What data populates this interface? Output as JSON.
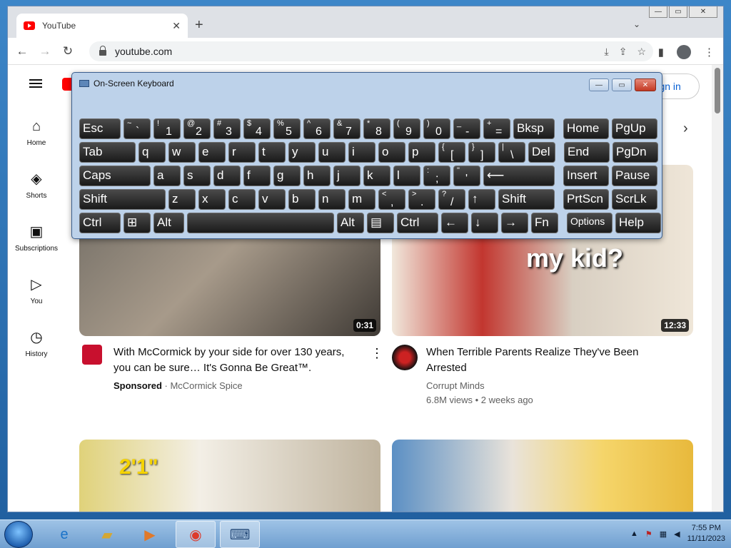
{
  "browser": {
    "tab_title": "YouTube",
    "url": "youtube.com"
  },
  "youtube": {
    "sign_in": "Sign in",
    "sidebar": [
      {
        "label": "Home",
        "icon": "home-icon"
      },
      {
        "label": "Shorts",
        "icon": "shorts-icon"
      },
      {
        "label": "Subscriptions",
        "icon": "subscriptions-icon"
      },
      {
        "label": "You",
        "icon": "you-icon"
      },
      {
        "label": "History",
        "icon": "history-icon"
      }
    ],
    "videos": [
      {
        "duration": "0:31",
        "title_line1": "With McCormick by your side for over 130 years,",
        "title_line2": "you can be sure… It's Gonna Be Great™.",
        "sponsored": "Sponsored",
        "channel": "McCormick Spice"
      },
      {
        "duration": "12:33",
        "overlay_text": "my kid?",
        "title_line1": "When Terrible Parents Realize They've Been",
        "title_line2": "Arrested",
        "channel": "Corrupt Minds",
        "stats": "6.8M views • 2 weeks ago"
      },
      {
        "overlay_text": "2'1\""
      },
      {}
    ]
  },
  "osk": {
    "title": "On-Screen Keyboard",
    "rows": [
      [
        "Esc",
        "~ `",
        "! 1",
        "@ 2",
        "# 3",
        "$ 4",
        "% 5",
        "^ 6",
        "& 7",
        "* 8",
        "( 9",
        ") 0",
        "_ -",
        "+ =",
        "Bksp",
        "Home",
        "PgUp"
      ],
      [
        "Tab",
        "q",
        "w",
        "e",
        "r",
        "t",
        "y",
        "u",
        "i",
        "o",
        "p",
        "{ [",
        "} ]",
        "| \\",
        "Del",
        "End",
        "PgDn"
      ],
      [
        "Caps",
        "a",
        "s",
        "d",
        "f",
        "g",
        "h",
        "j",
        "k",
        "l",
        ": ;",
        "\" '",
        "⟵",
        "Insert",
        "Pause"
      ],
      [
        "Shift",
        "z",
        "x",
        "c",
        "v",
        "b",
        "n",
        "m",
        "< ,",
        "> .",
        "? /",
        "↑",
        "Shift",
        "PrtScn",
        "ScrLk"
      ],
      [
        "Ctrl",
        "⊞",
        "Alt",
        "",
        "Alt",
        "▤",
        "Ctrl",
        "←",
        "↓",
        "→",
        "Fn",
        "Options",
        "Help"
      ]
    ]
  },
  "taskbar": {
    "time": "7:55 PM",
    "date": "11/11/2023"
  }
}
